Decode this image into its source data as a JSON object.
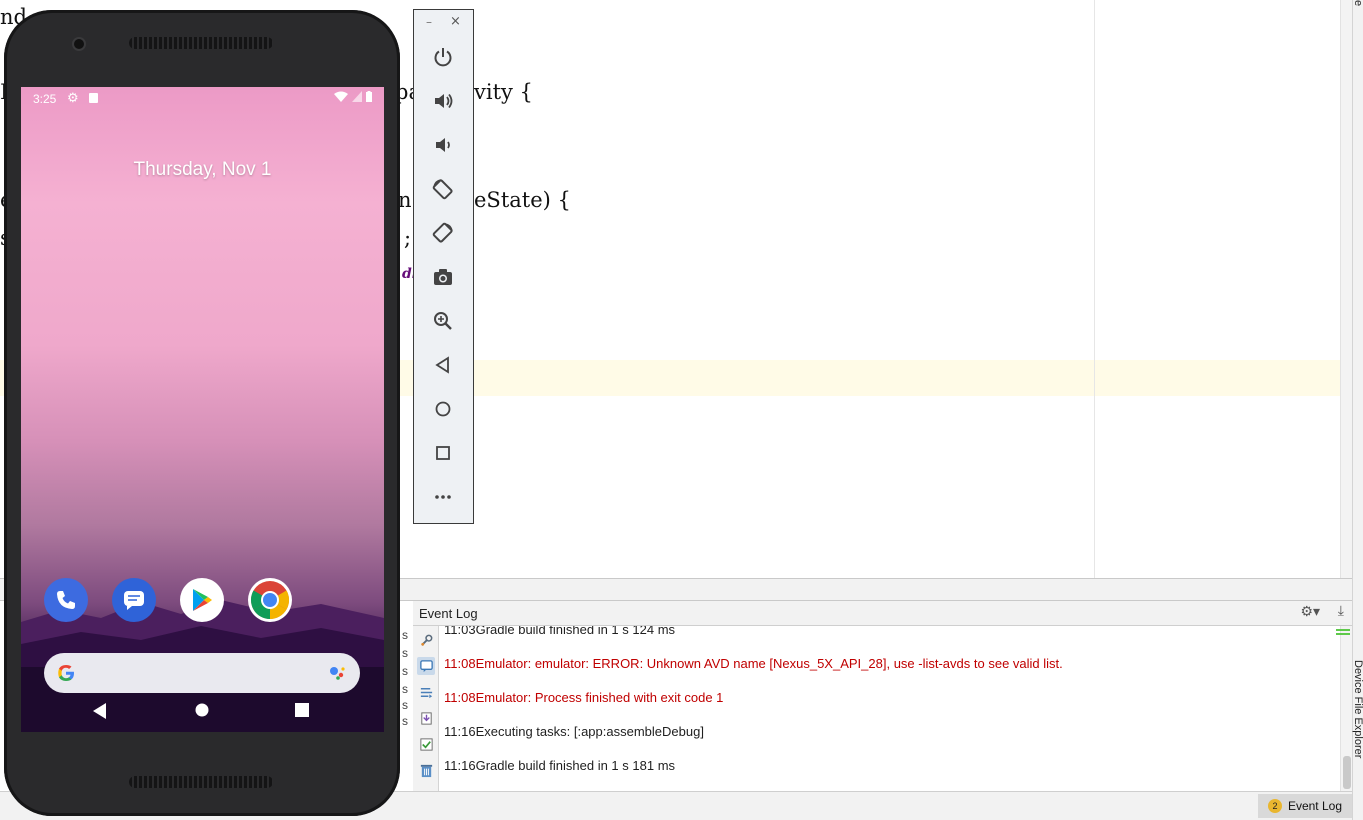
{
  "editor": {
    "code_fragments": [
      "nd",
      "I",
      "pa",
      "vity {",
      "e",
      "n",
      "eState) {",
      "s",
      ";",
      "dl"
    ]
  },
  "right_strip": {
    "top_tab": "e",
    "device_file_explorer": "Device File Explorer"
  },
  "phone": {
    "status_time": "3:25",
    "date": "Thursday, Nov 1",
    "apps": [
      "Phone",
      "Messages",
      "Play Store",
      "Chrome"
    ],
    "colors": {
      "phone_blue": "#3d6be0",
      "messages_blue": "#2f63d8",
      "chrome_red": "#db4437",
      "chrome_yellow": "#f4b400",
      "chrome_green": "#0f9d58"
    }
  },
  "emulator_toolbar": {
    "min_label": "–",
    "close_label": "×",
    "buttons": [
      "power-icon",
      "volume-up-icon",
      "volume-down-icon",
      "rotate-left-icon",
      "rotate-right-icon",
      "camera-icon",
      "zoom-icon",
      "back-icon",
      "home-icon",
      "overview-icon",
      "more-icon"
    ]
  },
  "event_log": {
    "title": "Event Log",
    "side_letters": [
      "s",
      "s",
      "s",
      "s",
      "s",
      "s"
    ],
    "lines": [
      {
        "time": "11:03",
        "text": "Gradle build finished in 1 s 124 ms",
        "kind": "ok"
      },
      {
        "time": "11:08",
        "text": "Emulator: emulator: ERROR: Unknown AVD name [Nexus_5X_API_28], use -list-avds to see valid list.",
        "kind": "err"
      },
      {
        "time": "11:08",
        "text": "Emulator: Process finished with exit code 1",
        "kind": "err"
      },
      {
        "time": "11:16",
        "text": "Executing tasks: [:app:assembleDebug]",
        "kind": "ok"
      },
      {
        "time": "11:16",
        "text": "Gradle build finished in 1 s 181 ms",
        "kind": "ok"
      }
    ]
  },
  "statusbar": {
    "event_log_count": "2",
    "event_log_label": "Event Log"
  }
}
